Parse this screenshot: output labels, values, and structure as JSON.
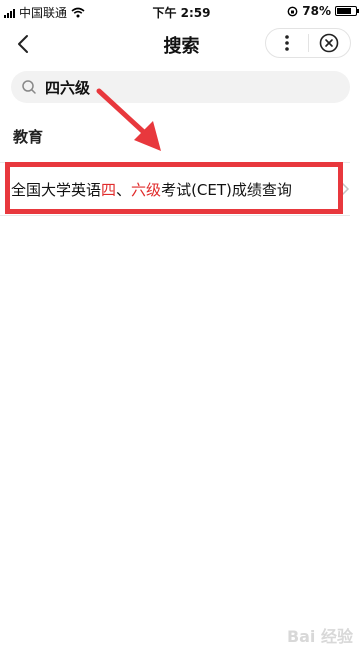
{
  "status_bar": {
    "carrier": "中国联通",
    "time": "下午 2:59",
    "battery": "78%",
    "battery_level": 0.78
  },
  "nav": {
    "title": "搜索"
  },
  "search": {
    "value": "四六级"
  },
  "section": {
    "title": "教育"
  },
  "result": {
    "parts": [
      {
        "text": "全国大学英语",
        "highlight": false
      },
      {
        "text": "四",
        "highlight": true
      },
      {
        "text": "、",
        "highlight": false
      },
      {
        "text": "六级",
        "highlight": true
      },
      {
        "text": "考试(CET)成绩查询",
        "highlight": false
      }
    ]
  },
  "watermark": "Bai 经验",
  "colors": {
    "highlight_text": "#e02b2b",
    "annotation_red": "#e8383d"
  }
}
